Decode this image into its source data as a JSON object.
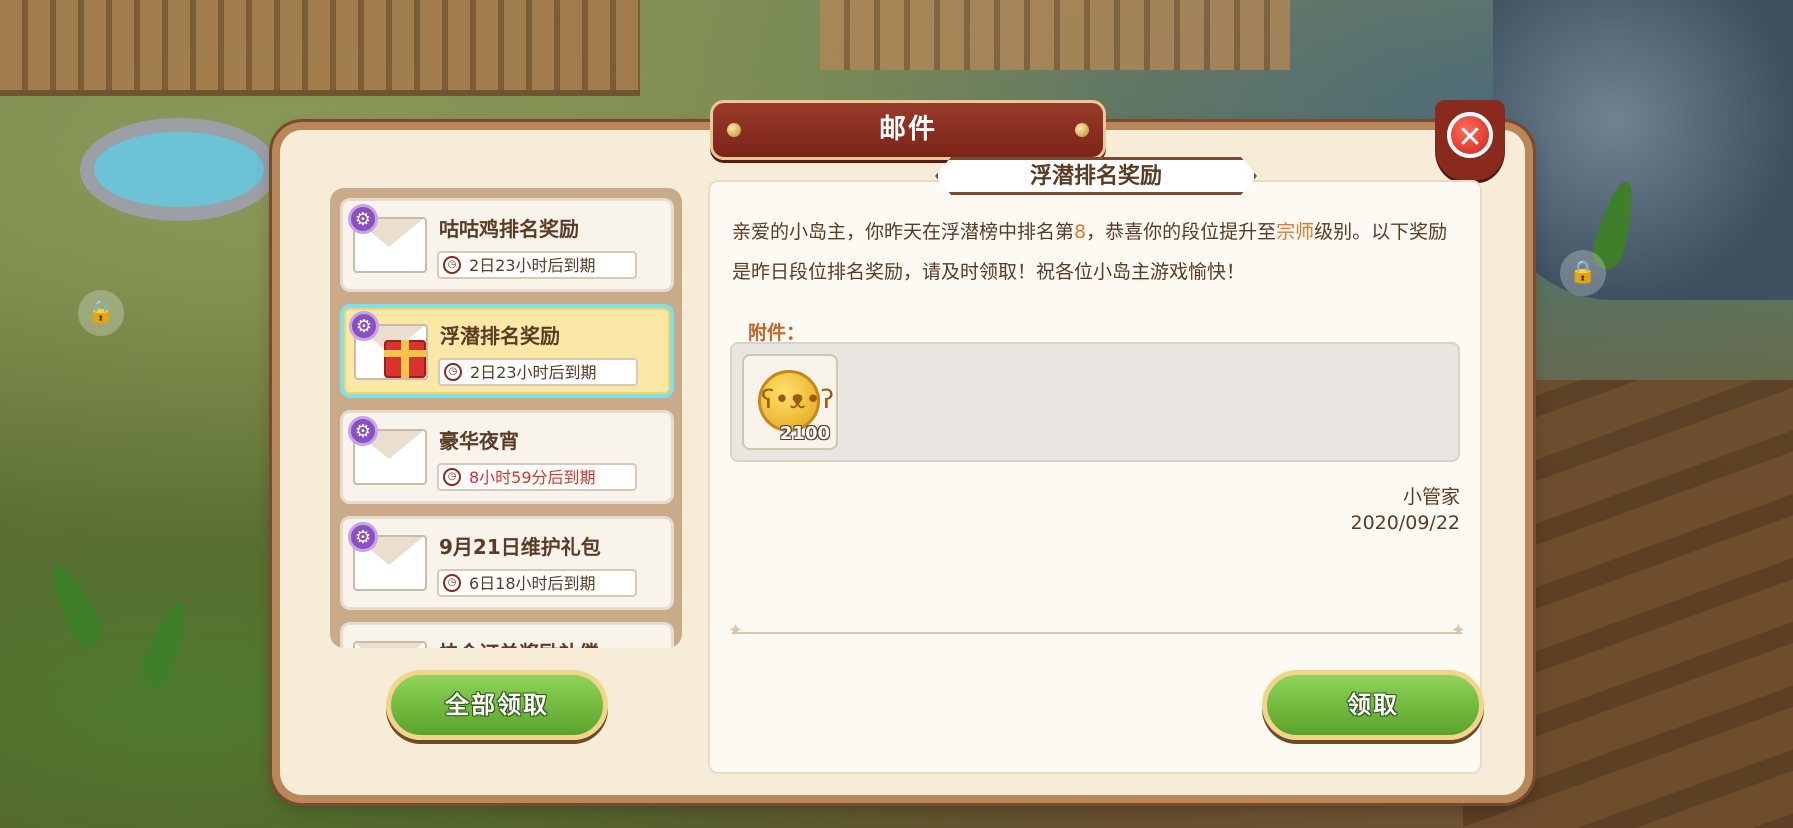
{
  "modal": {
    "title": "邮件"
  },
  "mail_list": [
    {
      "title": "咕咕鸡排名奖励",
      "expiry": "2日23小时后到期",
      "urgent": false,
      "gift": false,
      "selected": false
    },
    {
      "title": "浮潜排名奖励",
      "expiry": "2日23小时后到期",
      "urgent": false,
      "gift": true,
      "selected": true
    },
    {
      "title": "豪华夜宵",
      "expiry": "8小时59分后到期",
      "urgent": true,
      "gift": false,
      "selected": false
    },
    {
      "title": "9月21日维护礼包",
      "expiry": "6日18小时后到期",
      "urgent": false,
      "gift": false,
      "selected": false
    },
    {
      "title": "快会订单奖励补偿",
      "expiry": "",
      "urgent": false,
      "gift": false,
      "selected": false
    }
  ],
  "detail": {
    "title": "浮潜排名奖励",
    "body_part1": "亲爱的小岛主，你昨天在浮潜榜中排名第",
    "rank": "8",
    "body_part2": "，恭喜你的段位提升至",
    "tier": "宗师",
    "body_part3": "级别。以下奖励是昨日段位排名奖励，请及时领取！祝各位小岛主游戏愉快！",
    "attachment_label": "附件：",
    "attachments": [
      {
        "icon": "gold-coin-icon",
        "count": "2100"
      }
    ],
    "sender": "小管家",
    "date": "2020/09/22"
  },
  "buttons": {
    "claim_all": "全部领取",
    "claim": "领取"
  },
  "colors": {
    "accent_red": "#8a2a1d",
    "button_green": "#5aa32a",
    "highlight_orange": "#e5782a",
    "urgent_red": "#e0322a"
  }
}
